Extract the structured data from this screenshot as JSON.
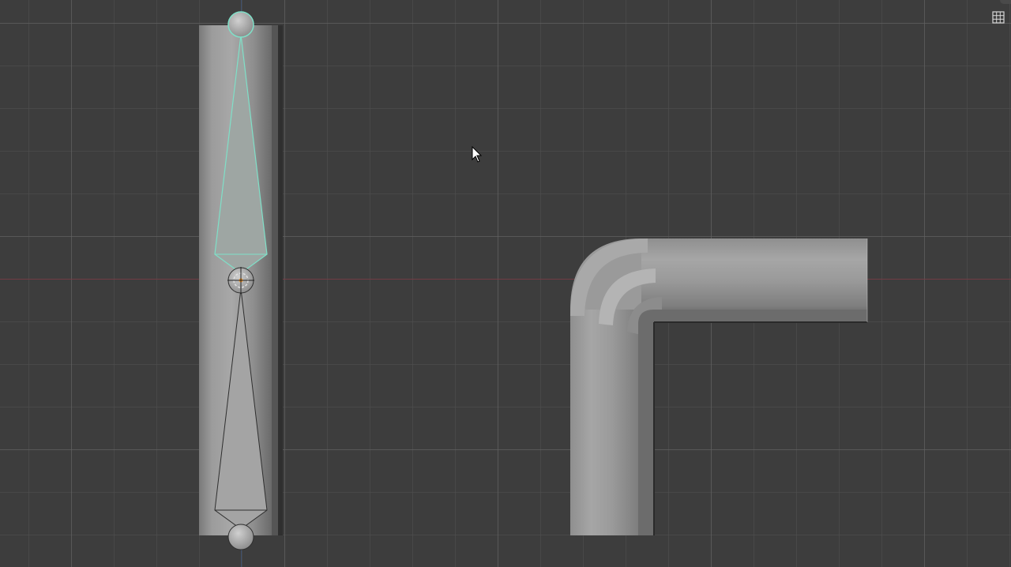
{
  "viewport": {
    "background_color": "#3d3d3d",
    "grid_color": "#505050",
    "x_axis_color": "#7a3a42",
    "y_axis_color": "#3f5f8f"
  },
  "armature": {
    "selected_bone_color": "#7fe0c8",
    "bone_color": "#a9a9a9"
  },
  "mesh": {
    "color": "#9a9a9a"
  },
  "header": {
    "grid_toggle_icon": "grid-icon"
  },
  "cursor": {
    "icon": "mouse-pointer-icon"
  }
}
